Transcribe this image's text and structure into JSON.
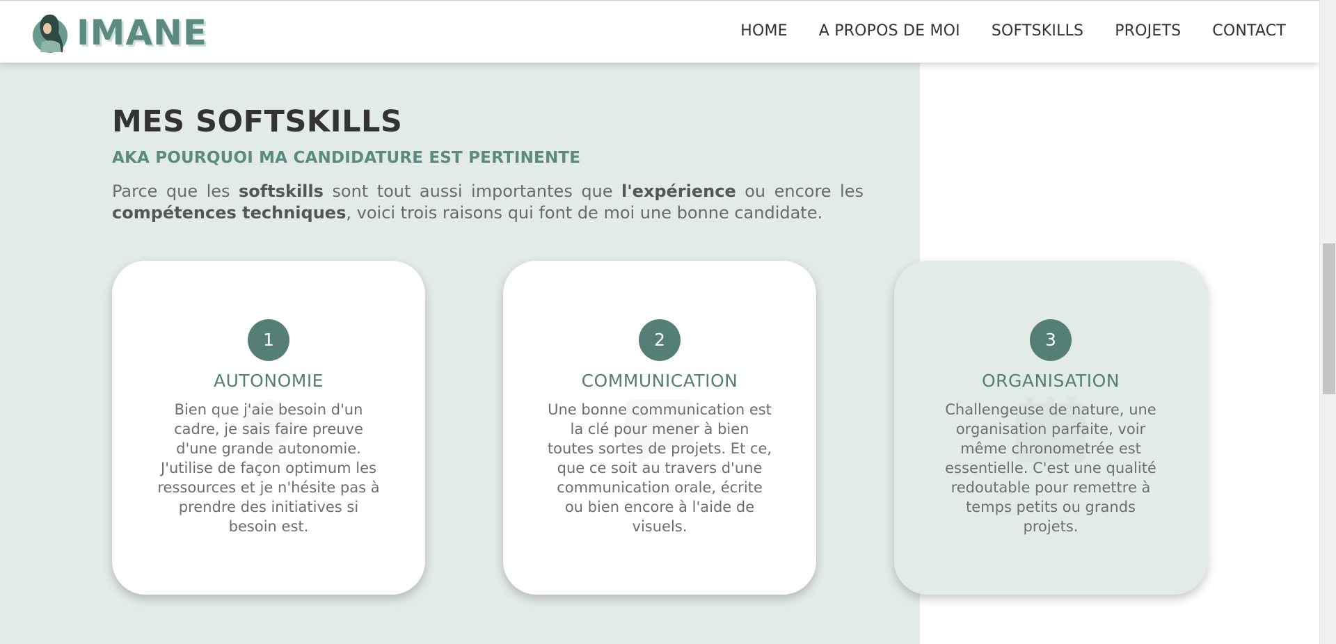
{
  "brand": {
    "name": "IMANE",
    "logo_icon": "woman-avatar-icon"
  },
  "nav": {
    "items": [
      {
        "label": "HOME"
      },
      {
        "label": "A PROPOS DE MOI"
      },
      {
        "label": "SOFTSKILLS"
      },
      {
        "label": "PROJETS"
      },
      {
        "label": "CONTACT"
      }
    ]
  },
  "softskills": {
    "title": "MES SOFTSKILLS",
    "subtitle": "AKA POURQUOI MA CANDIDATURE EST PERTINENTE",
    "intro": {
      "p1": "Parce que les ",
      "b1": "softskills",
      "p2": " sont tout aussi importantes que ",
      "b2": "l'expérience",
      "p3": " ou encore les ",
      "b3": "compétences techniques",
      "p4": ", voici trois raisons qui font de moi une bonne candidate."
    },
    "cards": [
      {
        "number": "1",
        "title": "AUTONOMIE",
        "text": "Bien que j'aie besoin d'un cadre, je sais faire preuve d'une grande autonomie. J'utilise de façon optimum les ressources et je n'hésite pas à prendre des initiatives si besoin est."
      },
      {
        "number": "2",
        "title": "COMMUNICATION",
        "text": "Une bonne communication est la clé pour mener à bien toutes sortes de projets. Et ce, que ce soit au travers d'une communication orale, écrite ou bien encore à l'aide de visuels."
      },
      {
        "number": "3",
        "title": "ORGANISATION",
        "text": "Challengeuse de nature, une organisation parfaite, voir même chronometrée est essentielle. C'est une qualité redoutable pour remettre à temps petits ou grands projets."
      }
    ]
  },
  "colors": {
    "accent": "#557f76",
    "section_bg": "#e3ebe8",
    "text": "#333333"
  }
}
